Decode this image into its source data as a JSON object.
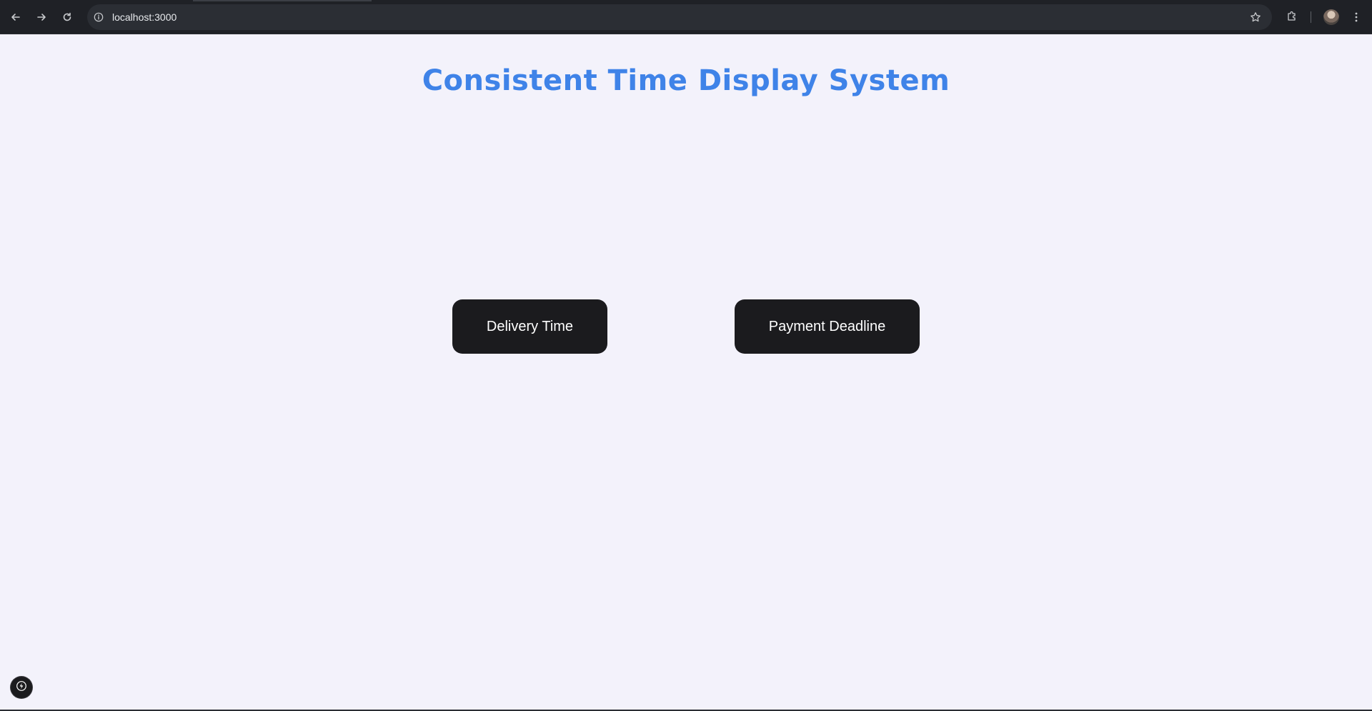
{
  "browser": {
    "url": "localhost:3000",
    "icons": {
      "back": "back-arrow-icon",
      "forward": "forward-arrow-icon",
      "reload": "reload-icon",
      "info": "info-icon",
      "bookmark": "star-icon",
      "extensions": "puzzle-icon",
      "menu": "kebab-menu-icon"
    }
  },
  "page": {
    "title": "Consistent Time Display System",
    "title_color": "#3f83e8",
    "buttons": {
      "delivery_label": "Delivery Time",
      "payment_label": "Payment Deadline"
    },
    "button_color": "#1b1b1e",
    "background": "#f3f2fb"
  },
  "dev_tools": {
    "icon": "lightning-icon"
  }
}
